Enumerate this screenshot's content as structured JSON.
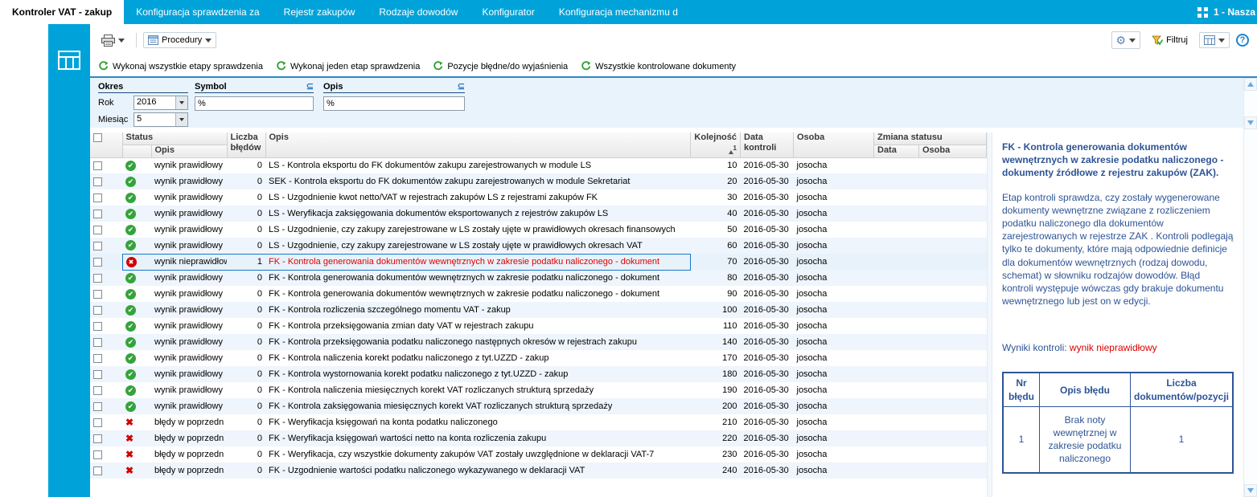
{
  "colors": {
    "accent": "#00a3d9",
    "selection": "#1878c8",
    "error_red": "#dd0000",
    "ok_green": "#35a33c",
    "detail_blue": "#2e5496"
  },
  "topbar": {
    "tabs": [
      {
        "label": "Kontroler VAT - zakup"
      },
      {
        "label": "Konfiguracja sprawdzenia za"
      },
      {
        "label": "Rejestr zakupów"
      },
      {
        "label": "Rodzaje dowodów"
      },
      {
        "label": "Konfigurator"
      },
      {
        "label": "Konfiguracja mechanizmu d"
      }
    ],
    "company_label": "1 - Nasza"
  },
  "toolbar": {
    "procedures_label": "Procedury",
    "filter_label": "Filtruj",
    "help_label": "?"
  },
  "actions": {
    "buttons": [
      "Wykonaj wszystkie etapy sprawdzenia",
      "Wykonaj jeden etap sprawdzenia",
      "Pozycje błędne/do wyjaśnienia",
      "Wszystkie kontrolowane dokumenty"
    ]
  },
  "filters": {
    "okres_label": "Okres",
    "rok_label": "Rok",
    "rok_value": "2016",
    "miesiac_label": "Miesiąc",
    "miesiac_value": "5",
    "symbol_label": "Symbol",
    "symbol_value": "%",
    "opis_label": "Opis",
    "opis_value": "%",
    "contains_operator": "⊆"
  },
  "grid": {
    "headers": {
      "status": "Status",
      "status_sub": "Opis",
      "liczba": "Liczba błędów",
      "opis": "Opis",
      "kolejnosc": "Kolejność",
      "sort_order": "1",
      "data_kontroli": "Data kontroli",
      "osoba": "Osoba",
      "zmiana": "Zmiana statusu",
      "zmiana_data": "Data",
      "zmiana_osoba": "Osoba"
    },
    "rows": [
      {
        "status": "ok",
        "status_text": "wynik prawidłowy",
        "liczba": "0",
        "opis": "LS - Kontrola eksportu do FK dokumentów zakupu zarejestrowanych w module LS",
        "kolejnosc": "10",
        "data": "2016-05-30",
        "osoba": "josocha"
      },
      {
        "status": "ok",
        "status_text": "wynik prawidłowy",
        "liczba": "0",
        "opis": "SEK - Kontrola eksportu do FK dokumentów zakupu zarejestrowanych w module Sekretariat",
        "kolejnosc": "20",
        "data": "2016-05-30",
        "osoba": "josocha"
      },
      {
        "status": "ok",
        "status_text": "wynik prawidłowy",
        "liczba": "0",
        "opis": "LS - Uzgodnienie kwot netto/VAT w rejestrach zakupów  LS  z rejestrami zakupów  FK",
        "kolejnosc": "30",
        "data": "2016-05-30",
        "osoba": "josocha"
      },
      {
        "status": "ok",
        "status_text": "wynik prawidłowy",
        "liczba": "0",
        "opis": "LS - Weryfikacja zaksięgowania dokumentów eksportowanych z rejestrów zakupów LS",
        "kolejnosc": "40",
        "data": "2016-05-30",
        "osoba": "josocha"
      },
      {
        "status": "ok",
        "status_text": "wynik prawidłowy",
        "liczba": "0",
        "opis": "LS - Uzgodnienie, czy zakupy zarejestrowane w LS zostały ujęte w prawidłowych okresach finansowych",
        "kolejnosc": "50",
        "data": "2016-05-30",
        "osoba": "josocha"
      },
      {
        "status": "ok",
        "status_text": "wynik prawidłowy",
        "liczba": "0",
        "opis": "LS - Uzgodnienie, czy zakupy zarejestrowane w LS zostały ujęte w prawidłowych okresach VAT",
        "kolejnosc": "60",
        "data": "2016-05-30",
        "osoba": "josocha"
      },
      {
        "status": "invalid",
        "status_text": "wynik nieprawidłowy",
        "liczba": "1",
        "opis": "FK - Kontrola generowania dokumentów wewnętrznych w zakresie podatku naliczonego - dokument",
        "kolejnosc": "70",
        "data": "2016-05-30",
        "osoba": "josocha",
        "selected": true
      },
      {
        "status": "ok",
        "status_text": "wynik prawidłowy",
        "liczba": "0",
        "opis": "FK - Kontrola generowania dokumentów wewnętrznych w zakresie podatku naliczonego - dokument",
        "kolejnosc": "80",
        "data": "2016-05-30",
        "osoba": "josocha"
      },
      {
        "status": "ok",
        "status_text": "wynik prawidłowy",
        "liczba": "0",
        "opis": "FK - Kontrola generowania dokumentów wewnętrznych w zakresie podatku naliczonego - dokument",
        "kolejnosc": "90",
        "data": "2016-05-30",
        "osoba": "josocha"
      },
      {
        "status": "ok",
        "status_text": "wynik prawidłowy",
        "liczba": "0",
        "opis": "FK - Kontrola rozliczenia szczególnego momentu VAT - zakup",
        "kolejnosc": "100",
        "data": "2016-05-30",
        "osoba": "josocha"
      },
      {
        "status": "ok",
        "status_text": "wynik prawidłowy",
        "liczba": "0",
        "opis": "FK - Kontrola przeksięgowania zmian daty VAT w rejestrach zakupu",
        "kolejnosc": "110",
        "data": "2016-05-30",
        "osoba": "josocha"
      },
      {
        "status": "ok",
        "status_text": "wynik prawidłowy",
        "liczba": "0",
        "opis": "FK - Kontrola przeksięgowania podatku naliczonego następnych okresów  w rejestrach zakupu",
        "kolejnosc": "140",
        "data": "2016-05-30",
        "osoba": "josocha"
      },
      {
        "status": "ok",
        "status_text": "wynik prawidłowy",
        "liczba": "0",
        "opis": "FK - Kontrola naliczenia korekt podatku naliczonego z tyt.UZZD - zakup",
        "kolejnosc": "170",
        "data": "2016-05-30",
        "osoba": "josocha"
      },
      {
        "status": "ok",
        "status_text": "wynik prawidłowy",
        "liczba": "0",
        "opis": "FK - Kontrola wystornowania korekt podatku naliczonego z tyt.UZZD - zakup",
        "kolejnosc": "180",
        "data": "2016-05-30",
        "osoba": "josocha"
      },
      {
        "status": "ok",
        "status_text": "wynik prawidłowy",
        "liczba": "0",
        "opis": "FK - Kontrola naliczenia miesięcznych korekt VAT rozliczanych strukturą sprzedaży",
        "kolejnosc": "190",
        "data": "2016-05-30",
        "osoba": "josocha"
      },
      {
        "status": "ok",
        "status_text": "wynik prawidłowy",
        "liczba": "0",
        "opis": "FK - Kontrola zaksięgowania miesięcznych korekt VAT rozliczanych strukturą sprzedaży",
        "kolejnosc": "200",
        "data": "2016-05-30",
        "osoba": "josocha"
      },
      {
        "status": "prev",
        "status_text": "błędy w poprzedn",
        "liczba": "0",
        "opis": "FK - Weryfikacja księgowań na konta podatku naliczonego",
        "kolejnosc": "210",
        "data": "2016-05-30",
        "osoba": "josocha"
      },
      {
        "status": "prev",
        "status_text": "błędy w poprzedn",
        "liczba": "0",
        "opis": "FK - Weryfikacja księgowań  wartości netto na konta  rozliczenia zakupu",
        "kolejnosc": "220",
        "data": "2016-05-30",
        "osoba": "josocha"
      },
      {
        "status": "prev",
        "status_text": "błędy w poprzedn",
        "liczba": "0",
        "opis": "FK - Weryfikacja, czy wszystkie dokumenty zakupów VAT zostały uwzględnione w deklaracji VAT-7",
        "kolejnosc": "230",
        "data": "2016-05-30",
        "osoba": "josocha"
      },
      {
        "status": "prev",
        "status_text": "błędy w poprzedn",
        "liczba": "0",
        "opis": "FK - Uzgodnienie wartości podatku naliczonego  wykazywanego w deklaracji VAT",
        "kolejnosc": "240",
        "data": "2016-05-30",
        "osoba": "josocha"
      }
    ]
  },
  "detail": {
    "title": "FK - Kontrola generowania dokumentów wewnętrznych w zakresie podatku naliczonego - dokumenty źródłowe z rejestru zakupów (ZAK).",
    "description": "Etap kontroli sprawdza, czy zostały wygenerowane dokumenty wewnętrzne  związane z rozliczeniem podatku naliczonego dla dokumentów zarejestrowanych w rejestrze ZAK . Kontroli podlegają tylko te dokumenty, które mają odpowiednie definicje dla dokumentów wewnętrznych (rodzaj dowodu, schemat) w słowniku rodzajów dowodów.  Błąd kontroli występuje wówczas gdy brakuje dokumentu wewnętrznego lub jest on w edycji.",
    "results_label": "Wyniki kontroli:",
    "results_value": "wynik nieprawidłowy",
    "errors_table": {
      "headers": [
        "Nr błędu",
        "Opis błędu",
        "Liczba dokumentów/pozycji"
      ],
      "rows": [
        {
          "nr": "1",
          "opis": "Brak noty wewnętrznej w zakresie podatku naliczonego",
          "liczba": "1"
        }
      ]
    }
  }
}
